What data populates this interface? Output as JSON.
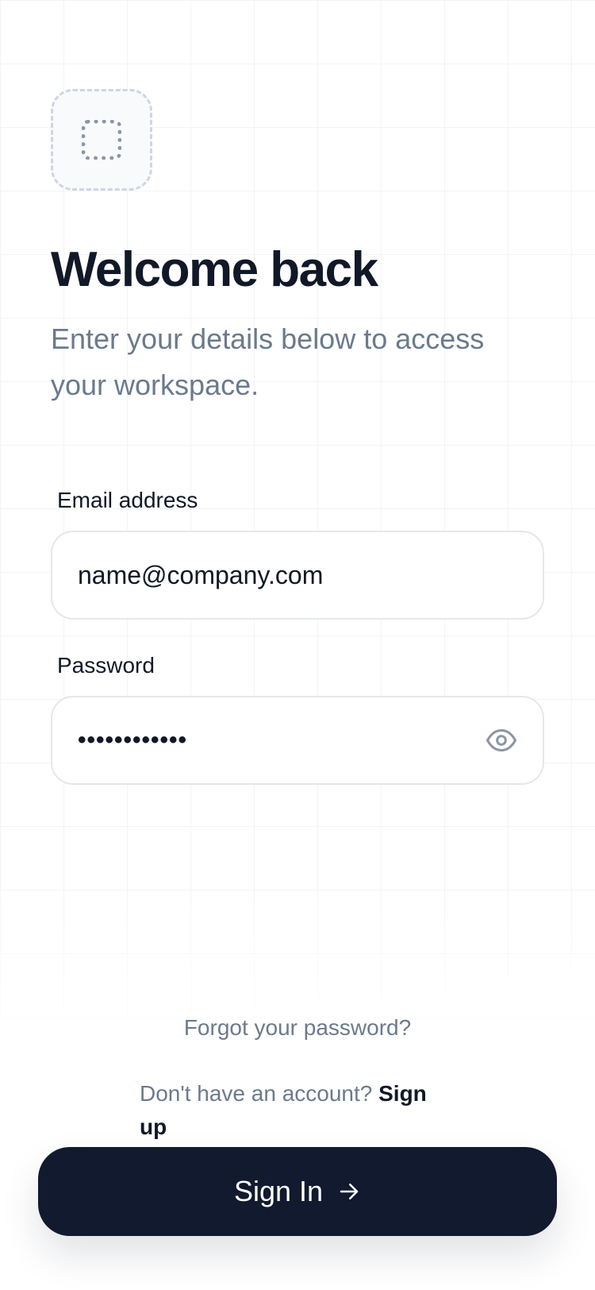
{
  "header": {
    "logo_icon": "placeholder-logo-icon",
    "title": "Welcome back",
    "subtitle": "Enter your details below to access your workspace."
  },
  "form": {
    "email": {
      "label": "Email address",
      "value": "name@company.com"
    },
    "password": {
      "label": "Password",
      "masked_value": "••••••••••••",
      "toggle_icon": "eye-icon"
    }
  },
  "links": {
    "forgot_password": "Forgot your password?",
    "signup_prompt": "Don't have an account?",
    "signup_link": "Sign up"
  },
  "actions": {
    "signin_label": "Sign In",
    "signin_icon": "arrow-right-icon"
  },
  "colors": {
    "primary_dark": "#111a2e",
    "heading": "#111827",
    "muted_text": "#6b7a8d",
    "field_border": "#e5e7eb",
    "background": "#ffffff"
  }
}
